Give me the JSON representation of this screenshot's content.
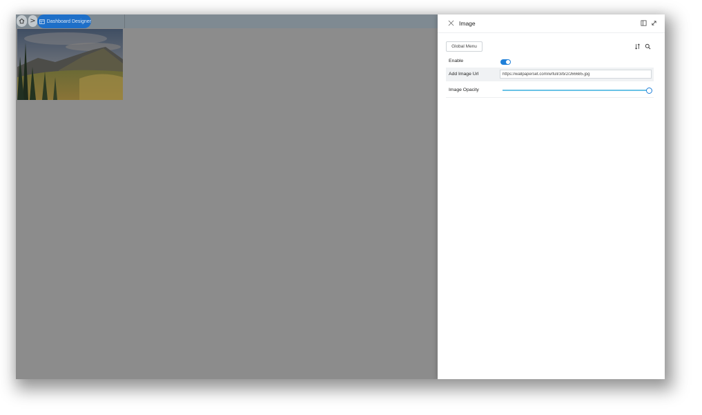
{
  "breadcrumb": {
    "home_icon": "home-icon",
    "separator": ">",
    "active_label": "Dashboard Designer",
    "active_icon": "dashboard-icon"
  },
  "canvas": {
    "image_alt": "mountain landscape image",
    "background": "#8c8c8c"
  },
  "panel": {
    "title": "Image",
    "global_menu_label": "Global Menu",
    "properties": {
      "enable_label": "Enable",
      "enable_value": true,
      "url_label": "Add Image Url",
      "url_value": "https://wallpaperset.com/w/full/3/b/2/266685.jpg",
      "opacity_label": "Image Opacity",
      "opacity_value": 1.0
    }
  },
  "colors": {
    "accent": "#1e6fc8",
    "toggle": "#1e7fd8",
    "slider": "#69c2e6"
  }
}
